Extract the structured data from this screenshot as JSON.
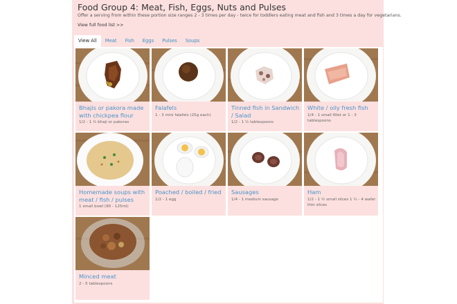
{
  "header": {
    "title": "Food Group 4: Meat, Fish, Eggs, Nuts and Pulses",
    "subtitle": "Offer a serving from within these portion size ranges 2 - 3 times per day - twice for toddlers eating meat and fish and 3 times a day for vegetarians.",
    "full_list_link": "View full food list >>"
  },
  "tabs": [
    {
      "label": "View All",
      "active": true
    },
    {
      "label": "Meat",
      "active": false
    },
    {
      "label": "Fish",
      "active": false
    },
    {
      "label": "Eggs",
      "active": false
    },
    {
      "label": "Pulses",
      "active": false
    },
    {
      "label": "Soups",
      "active": false
    }
  ],
  "foods": [
    {
      "name": "Bhajis or pakora made with chickpea flour",
      "portion": "1/2 - 1 ½ bhaji or pakoras",
      "icon": "bhaji-photo-icon"
    },
    {
      "name": "Falafels",
      "portion": "1 - 3 mini falafels (25g each)",
      "icon": "falafel-photo-icon"
    },
    {
      "name": "Tinned fish in Sandwich / Salad",
      "portion": "1/2 - 1 ½ tablespoons",
      "icon": "tinned-fish-photo-icon"
    },
    {
      "name": "White / oily fresh fish",
      "portion": "1/4 - 1 small fillet or 1 - 3 tablespoons",
      "icon": "fresh-fish-photo-icon"
    },
    {
      "name": "Homemade soups with meat / fish / pulses",
      "portion": "1 small bowl (90 - 125ml)",
      "icon": "soup-photo-icon"
    },
    {
      "name": "Poached / boiled / fried",
      "portion": "1/2 - 1 egg",
      "icon": "egg-photo-icon"
    },
    {
      "name": "Sausages",
      "portion": "1/4 - 1 medium sausage",
      "icon": "sausage-photo-icon"
    },
    {
      "name": "Ham",
      "portion": "1/2 - 1 ½ small slices 1 ½ - 4 wafer thin slices",
      "icon": "ham-photo-icon"
    },
    {
      "name": "Minced meat",
      "portion": "2 - 5 tablespoons",
      "icon": "minced-meat-photo-icon"
    }
  ],
  "colors": {
    "panel_bg": "#fce0df",
    "link_blue": "#4a93c9",
    "wood": "#a07850"
  }
}
